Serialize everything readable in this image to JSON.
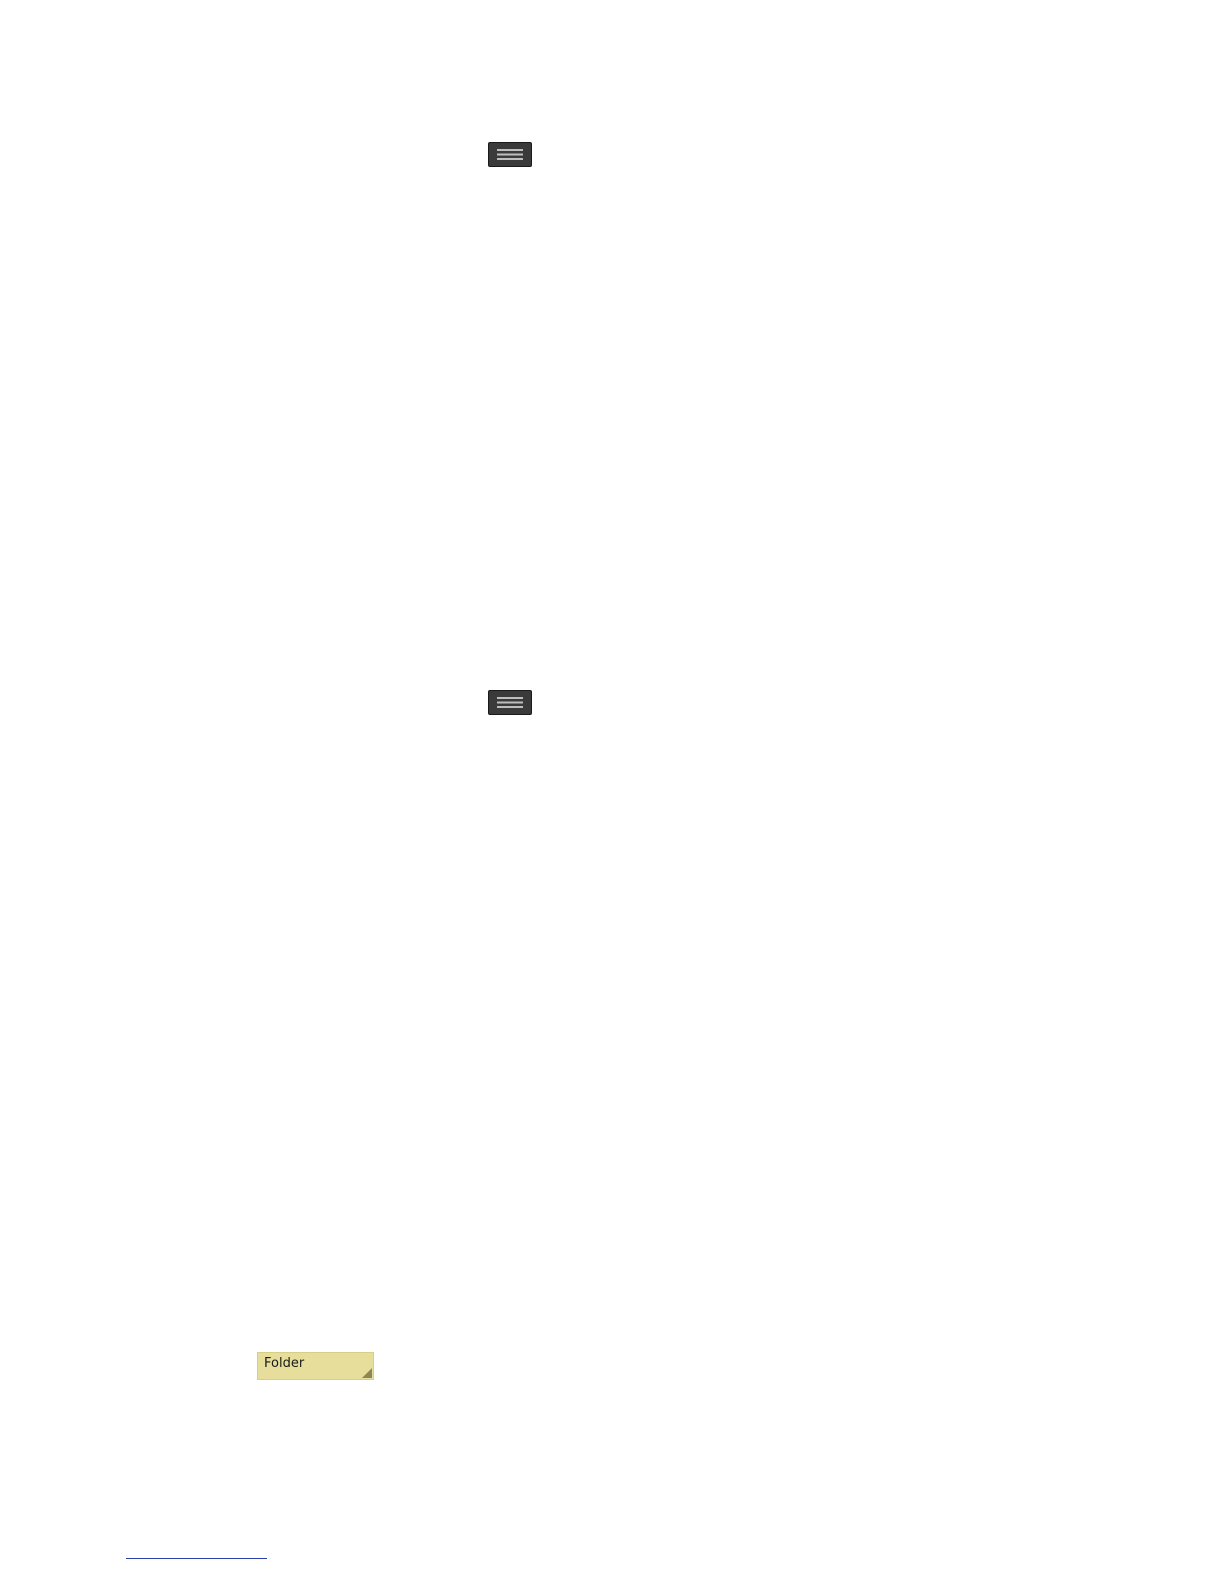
{
  "icons": {
    "menu_key": "menu-key-icon"
  },
  "folder_tab": {
    "label": "Folder"
  },
  "colors": {
    "menu_key_bg": "#3a3a3a",
    "folder_bg": "#e6de9a",
    "folder_corner": "#8d8655",
    "footnote_rule": "#2b3fa8"
  }
}
